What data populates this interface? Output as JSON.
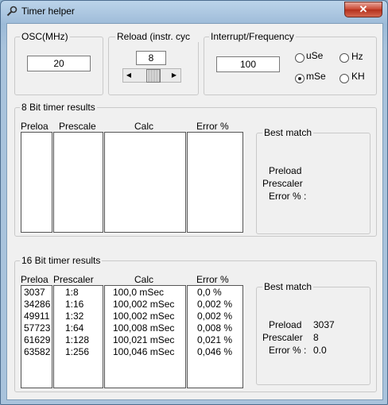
{
  "window": {
    "title": "Timer helper",
    "close_glyph": "✕",
    "accent": "#c8442f"
  },
  "osc": {
    "label": "OSC(MHz)",
    "value": "20"
  },
  "reload": {
    "label": "Reload (instr. cyc",
    "value": "8"
  },
  "interrupt": {
    "label": "Interrupt/Frequency",
    "value": "100",
    "options": [
      {
        "label": "uSe",
        "selected": false
      },
      {
        "label": "Hz",
        "selected": false
      },
      {
        "label": "mSe",
        "selected": true
      },
      {
        "label": "KH",
        "selected": false
      }
    ]
  },
  "timer8": {
    "label": "8 Bit timer results",
    "headers": [
      "Preloa",
      "Prescale",
      "Calc",
      "Error %"
    ],
    "best_match": {
      "title": "Best match",
      "preload_label": "Preload",
      "prescaler_label": "Prescaler",
      "error_label": "Error % :"
    }
  },
  "timer16": {
    "label": "16 Bit timer results",
    "headers": [
      "Preloa",
      "Prescaler",
      "Calc",
      "Error %"
    ],
    "rows": [
      {
        "preload": "3037",
        "prescaler": "1:8",
        "calc": "100,0 mSec",
        "error": "0,0 %"
      },
      {
        "preload": "34286",
        "prescaler": "1:16",
        "calc": "100,002 mSec",
        "error": "0,002 %"
      },
      {
        "preload": "49911",
        "prescaler": "1:32",
        "calc": "100,002 mSec",
        "error": "0,002 %"
      },
      {
        "preload": "57723",
        "prescaler": "1:64",
        "calc": "100,008 mSec",
        "error": "0,008 %"
      },
      {
        "preload": "61629",
        "prescaler": "1:128",
        "calc": "100,021 mSec",
        "error": "0,021 %"
      },
      {
        "preload": "63582",
        "prescaler": "1:256",
        "calc": "100,046 mSec",
        "error": "0,046 %"
      }
    ],
    "best_match": {
      "title": "Best match",
      "preload_label": "Preload",
      "preload_value": "3037",
      "prescaler_label": "Prescaler",
      "prescaler_value": "8",
      "error_label": "Error % :",
      "error_value": "0.0"
    }
  }
}
